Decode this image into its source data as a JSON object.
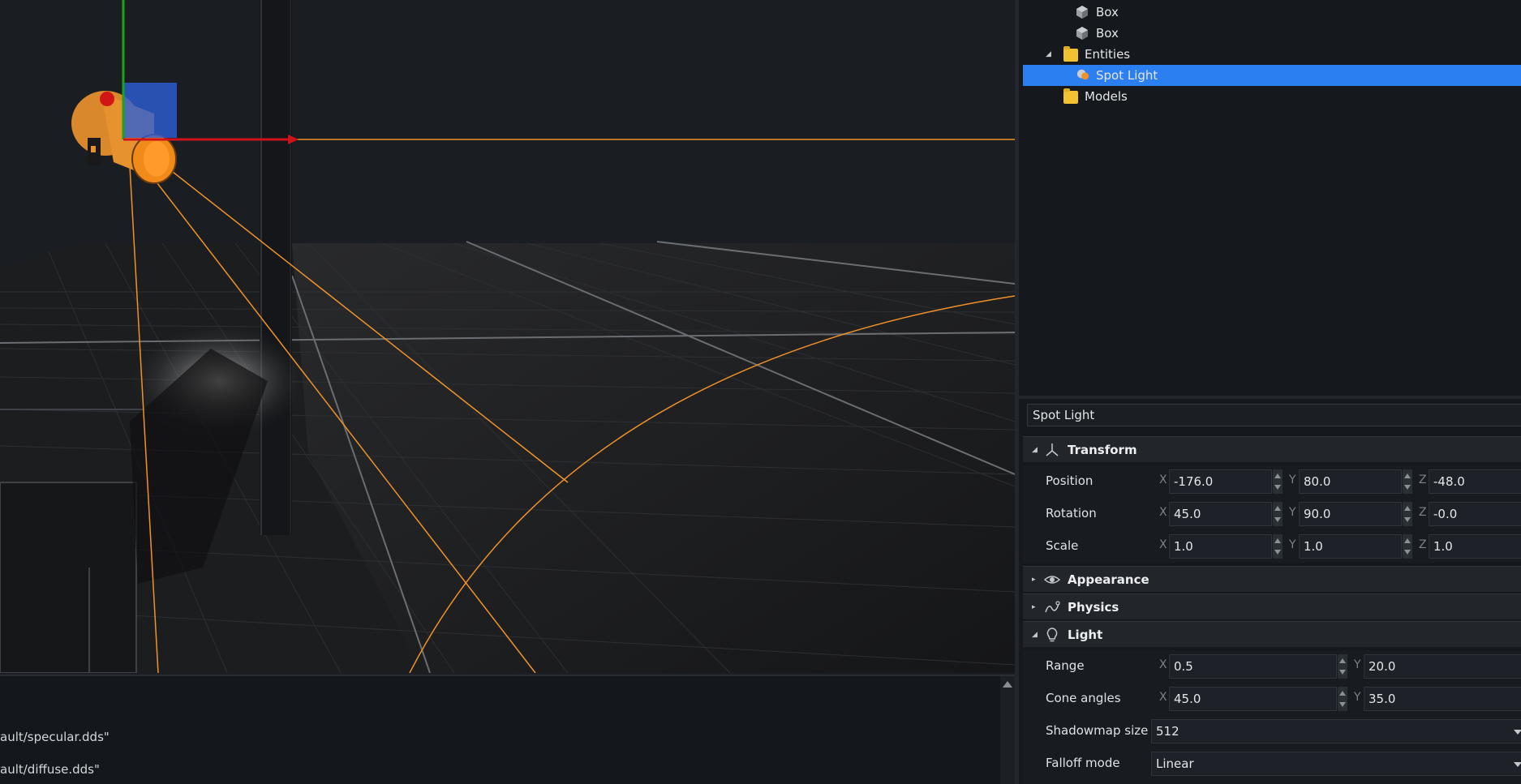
{
  "scene_tree": {
    "items": [
      {
        "label": "Box",
        "icon": "box-icon"
      },
      {
        "label": "Box",
        "icon": "box-icon"
      },
      {
        "label": "Entities",
        "icon": "folder-icon",
        "expanded": true
      },
      {
        "label": "Spot Light",
        "icon": "spot-light-icon",
        "selected": true
      },
      {
        "label": "Models",
        "icon": "folder-icon"
      }
    ]
  },
  "inspector": {
    "name": "Spot Light",
    "transform": {
      "title": "Transform",
      "position": {
        "label": "Position",
        "x": "-176.0",
        "y": "80.0",
        "z": "-48.0"
      },
      "rotation": {
        "label": "Rotation",
        "x": "45.0",
        "y": "90.0",
        "z": "-0.0"
      },
      "scale": {
        "label": "Scale",
        "x": "1.0",
        "y": "1.0",
        "z": "1.0"
      }
    },
    "appearance": {
      "title": "Appearance"
    },
    "physics": {
      "title": "Physics"
    },
    "light": {
      "title": "Light",
      "range": {
        "label": "Range",
        "x": "0.5",
        "y": "20.0"
      },
      "cone_angles": {
        "label": "Cone angles",
        "x": "45.0",
        "y": "35.0"
      },
      "shadowmap_size": {
        "label": "Shadowmap size",
        "value": "512"
      },
      "falloff_mode": {
        "label": "Falloff mode",
        "value": "Linear"
      }
    },
    "axis_labels": {
      "x": "X",
      "y": "Y",
      "z": "Z"
    }
  },
  "console": {
    "lines": [
      "ault/specular.dds\"",
      "ault/diffuse.dds\""
    ]
  },
  "colors": {
    "selection": "#2b7ff0",
    "gizmo_x": "#d0131a",
    "gizmo_y": "#1aa51a",
    "gizmo_z": "#2d5fd6",
    "light_body": "#e5922f",
    "light_cone": "#f0922a"
  }
}
